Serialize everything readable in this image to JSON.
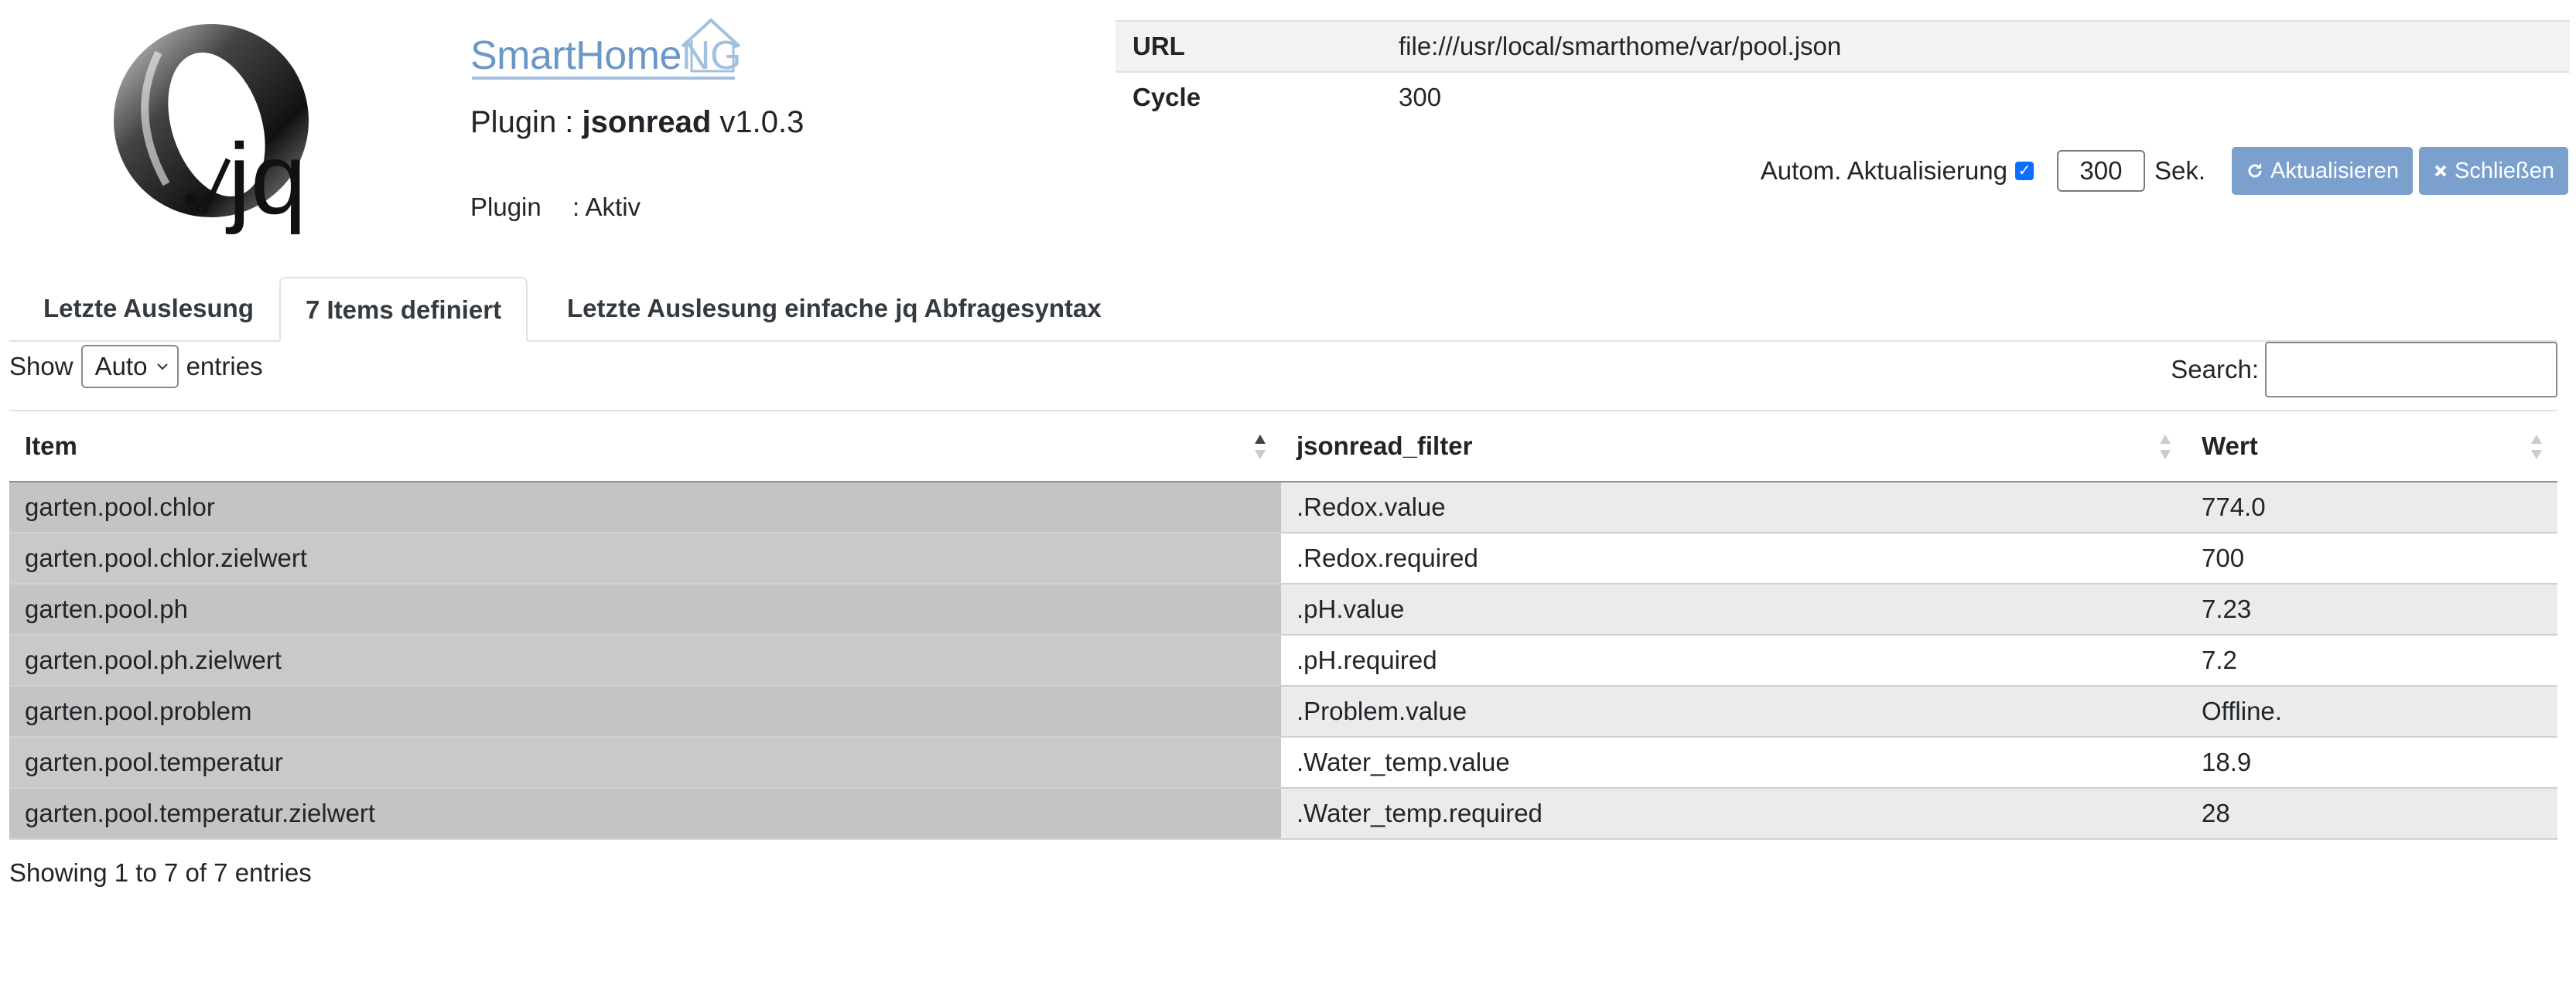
{
  "brand": {
    "name_a": "SmartHome",
    "name_b": "NG"
  },
  "plugin": {
    "prefix": "Plugin : ",
    "name": "jsonread",
    "version": " v1.0.3",
    "status_label": "Plugin",
    "status_value": ": Aktiv"
  },
  "config": [
    {
      "key": "URL",
      "value": "file:///usr/local/smarthome/var/pool.json"
    },
    {
      "key": "Cycle",
      "value": "300"
    }
  ],
  "autoupdate": {
    "label": "Autom. Aktualisierung",
    "checked": true,
    "seconds": "300",
    "unit": "Sek.",
    "refresh_label": "Aktualisieren",
    "close_label": "Schließen"
  },
  "tabs": [
    {
      "label": "Letzte Auslesung",
      "active": false
    },
    {
      "label": "7 Items definiert",
      "active": true
    },
    {
      "label": "Letzte Auslesung einfache jq Abfragesyntax",
      "active": false
    }
  ],
  "table_controls": {
    "show_label": "Show",
    "entries_value": "Auto",
    "entries_label": "entries",
    "search_label": "Search:",
    "search_value": ""
  },
  "table": {
    "columns": [
      "Item",
      "jsonread_filter",
      "Wert"
    ],
    "rows": [
      [
        "garten.pool.chlor",
        ".Redox.value",
        "774.0"
      ],
      [
        "garten.pool.chlor.zielwert",
        ".Redox.required",
        "700"
      ],
      [
        "garten.pool.ph",
        ".pH.value",
        "7.23"
      ],
      [
        "garten.pool.ph.zielwert",
        ".pH.required",
        "7.2"
      ],
      [
        "garten.pool.problem",
        ".Problem.value",
        "Offline."
      ],
      [
        "garten.pool.temperatur",
        ".Water_temp.value",
        "18.9"
      ],
      [
        "garten.pool.temperatur.zielwert",
        ".Water_temp.required",
        "28"
      ]
    ],
    "info": "Showing 1 to 7 of 7 entries"
  },
  "colors": {
    "button": "#7ca0ce",
    "brand": "#6a97c7",
    "checkbox": "#0d6efd"
  }
}
